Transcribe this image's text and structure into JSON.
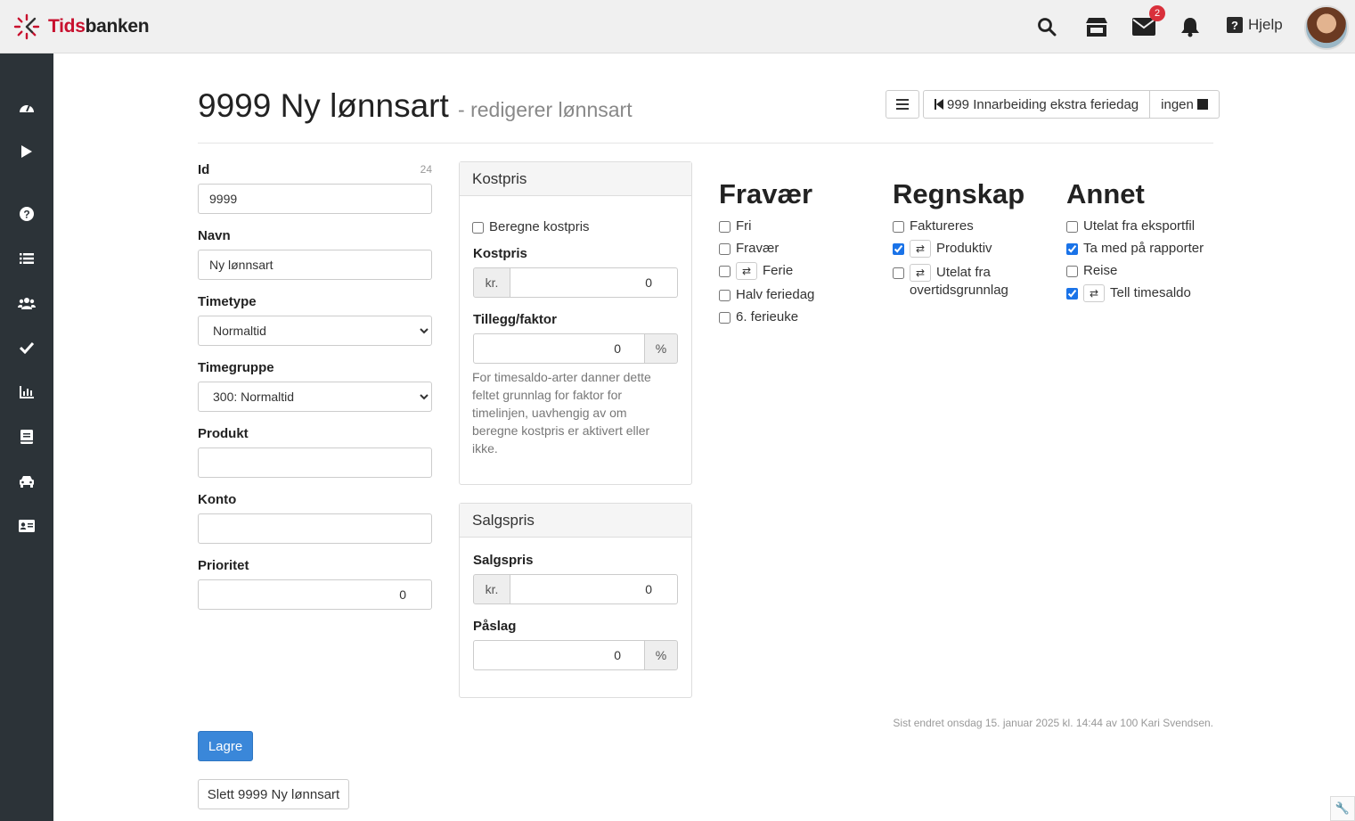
{
  "app": {
    "logo_text_a": "Tids",
    "logo_text_b": "banken"
  },
  "topbar": {
    "mail_badge": "2",
    "help_label": "Hjelp"
  },
  "sidebar": {
    "items": [
      "dashboard-icon",
      "play-icon",
      "help-icon",
      "list-icon",
      "users-icon",
      "check-icon",
      "chart-icon",
      "book-icon",
      "car-icon",
      "id-card-icon"
    ]
  },
  "header": {
    "title": "9999 Ny lønnsart",
    "subtitle": "- redigerer lønnsart",
    "prev_label": "999 Innarbeiding ekstra feriedag",
    "next_label": "ingen"
  },
  "form": {
    "id_label": "Id",
    "id_count": "24",
    "id_value": "9999",
    "navn_label": "Navn",
    "navn_value": "Ny lønnsart",
    "timetype_label": "Timetype",
    "timetype_value": "Normaltid",
    "timegruppe_label": "Timegruppe",
    "timegruppe_value": "300: Normaltid",
    "produkt_label": "Produkt",
    "produkt_value": "",
    "konto_label": "Konto",
    "konto_value": "",
    "prioritet_label": "Prioritet",
    "prioritet_value": "0"
  },
  "kostpris_panel": {
    "title": "Kostpris",
    "beregne_label": "Beregne kostpris",
    "kostpris_label": "Kostpris",
    "kostpris_prefix": "kr.",
    "kostpris_value": "0",
    "tillegg_label": "Tillegg/faktor",
    "tillegg_value": "0",
    "tillegg_suffix": "%",
    "help_text": "For timesaldo-arter danner dette feltet grunnlag for faktor for timelinjen, uavhengig av om beregne kostpris er aktivert eller ikke."
  },
  "salgspris_panel": {
    "title": "Salgspris",
    "salgspris_label": "Salgspris",
    "salgspris_prefix": "kr.",
    "salgspris_value": "0",
    "paslag_label": "Påslag",
    "paslag_value": "0",
    "paslag_suffix": "%"
  },
  "fravaer": {
    "title": "Fravær",
    "items": [
      {
        "label": "Fri",
        "checked": false,
        "sync": false
      },
      {
        "label": "Fravær",
        "checked": false,
        "sync": false
      },
      {
        "label": "Ferie",
        "checked": false,
        "sync": true
      },
      {
        "label": "Halv feriedag",
        "checked": false,
        "sync": false
      },
      {
        "label": "6. ferieuke",
        "checked": false,
        "sync": false
      }
    ]
  },
  "regnskap": {
    "title": "Regnskap",
    "items": [
      {
        "label": "Faktureres",
        "checked": false,
        "sync": false
      },
      {
        "label": "Produktiv",
        "checked": true,
        "sync": true
      },
      {
        "label": "Utelat fra overtidsgrunnlag",
        "checked": false,
        "sync": true
      }
    ]
  },
  "annet": {
    "title": "Annet",
    "items": [
      {
        "label": "Utelat fra eksportfil",
        "checked": false,
        "sync": false
      },
      {
        "label": "Ta med på rapporter",
        "checked": true,
        "sync": false
      },
      {
        "label": "Reise",
        "checked": false,
        "sync": false
      },
      {
        "label": "Tell timesaldo",
        "checked": true,
        "sync": true
      }
    ]
  },
  "footer": {
    "last_changed": "Sist endret onsdag 15. januar 2025 kl. 14:44 av 100 Kari Svendsen.",
    "save_label": "Lagre",
    "delete_label": "Slett 9999 Ny lønnsart"
  },
  "colors": {
    "sidebar": "#2c3338",
    "primary": "#3a87d9",
    "badge": "#d9303b",
    "logo_accent": "#c8102e"
  }
}
